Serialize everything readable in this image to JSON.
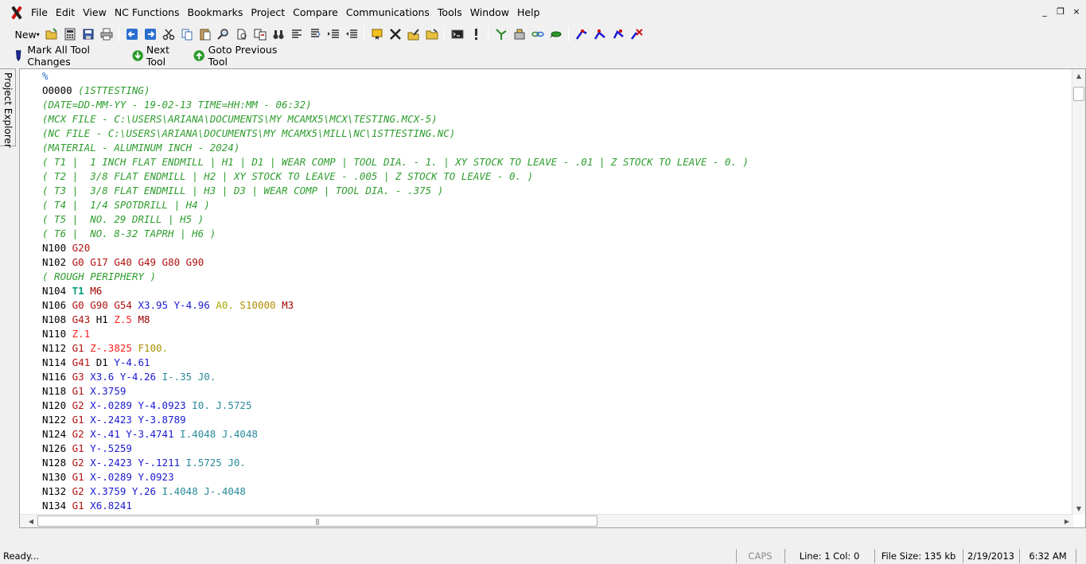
{
  "menubar": {
    "items": [
      "File",
      "Edit",
      "View",
      "NC Functions",
      "Bookmarks",
      "Project",
      "Compare",
      "Communications",
      "Tools",
      "Window",
      "Help"
    ],
    "mdi_controls": [
      "_",
      "❐",
      "×"
    ]
  },
  "toolbar": {
    "new_label": "New",
    "new_arrow": "▾"
  },
  "toolbar2": {
    "mark_all": "Mark All Tool Changes",
    "next_tool": "Next Tool",
    "goto_previous": "Goto Previous Tool"
  },
  "side_panel": {
    "label": "Project Explorer"
  },
  "editor": {
    "lines": [
      [
        [
          "P",
          "%"
        ]
      ],
      [
        [
          "O",
          "O0000"
        ],
        [
          "c",
          "(1STTESTING)"
        ]
      ],
      [
        [
          "c",
          "(DATE=DD-MM-YY - 19-02-13 TIME=HH:MM - 06:32)"
        ]
      ],
      [
        [
          "c",
          "(MCX FILE - C:\\USERS\\ARIANA\\DOCUMENTS\\MY MCAMX5\\MCX\\TESTING.MCX-5)"
        ]
      ],
      [
        [
          "c",
          "(NC FILE - C:\\USERS\\ARIANA\\DOCUMENTS\\MY MCAMX5\\MILL\\NC\\1STTESTING.NC)"
        ]
      ],
      [
        [
          "c",
          "(MATERIAL - ALUMINUM INCH - 2024)"
        ]
      ],
      [
        [
          "c",
          "( T1 |  1 INCH FLAT ENDMILL | H1 | D1 | WEAR COMP | TOOL DIA. - 1. | XY STOCK TO LEAVE - .01 | Z STOCK TO LEAVE - 0. )"
        ]
      ],
      [
        [
          "c",
          "( T2 |  3/8 FLAT ENDMILL | H2 | XY STOCK TO LEAVE - .005 | Z STOCK TO LEAVE - 0. )"
        ]
      ],
      [
        [
          "c",
          "( T3 |  3/8 FLAT ENDMILL | H3 | D3 | WEAR COMP | TOOL DIA. - .375 )"
        ]
      ],
      [
        [
          "c",
          "( T4 |  1/4 SPOTDRILL | H4 )"
        ]
      ],
      [
        [
          "c",
          "( T5 |  NO. 29 DRILL | H5 )"
        ]
      ],
      [
        [
          "c",
          "( T6 |  NO. 8-32 TAPRH | H6 )"
        ]
      ],
      [
        [
          "N",
          "N100"
        ],
        [
          "G",
          "G20"
        ]
      ],
      [
        [
          "N",
          "N102"
        ],
        [
          "G",
          "G0"
        ],
        [
          "G",
          "G17"
        ],
        [
          "G",
          "G40"
        ],
        [
          "G",
          "G49"
        ],
        [
          "G",
          "G80"
        ],
        [
          "G",
          "G90"
        ]
      ],
      [
        [
          "c",
          "( ROUGH PERIPHERY )"
        ]
      ],
      [
        [
          "N",
          "N104"
        ],
        [
          "T",
          "T1"
        ],
        [
          "M",
          "M6"
        ]
      ],
      [
        [
          "N",
          "N106"
        ],
        [
          "G",
          "G0"
        ],
        [
          "G",
          "G90"
        ],
        [
          "G",
          "G54"
        ],
        [
          "X",
          "X3.95"
        ],
        [
          "Y",
          "Y-4.96"
        ],
        [
          "A",
          "A0."
        ],
        [
          "S",
          "S10000"
        ],
        [
          "M",
          "M3"
        ]
      ],
      [
        [
          "N",
          "N108"
        ],
        [
          "G",
          "G43"
        ],
        [
          "H",
          "H1"
        ],
        [
          "Z",
          "Z.5"
        ],
        [
          "M",
          "M8"
        ]
      ],
      [
        [
          "N",
          "N110"
        ],
        [
          "Z",
          "Z.1"
        ]
      ],
      [
        [
          "N",
          "N112"
        ],
        [
          "G",
          "G1"
        ],
        [
          "Z",
          "Z-.3825"
        ],
        [
          "F",
          "F100."
        ]
      ],
      [
        [
          "N",
          "N114"
        ],
        [
          "G",
          "G41"
        ],
        [
          "D",
          "D1"
        ],
        [
          "Y",
          "Y-4.61"
        ]
      ],
      [
        [
          "N",
          "N116"
        ],
        [
          "G",
          "G3"
        ],
        [
          "X",
          "X3.6"
        ],
        [
          "Y",
          "Y-4.26"
        ],
        [
          "I",
          "I-.35"
        ],
        [
          "J",
          "J0."
        ]
      ],
      [
        [
          "N",
          "N118"
        ],
        [
          "G",
          "G1"
        ],
        [
          "X",
          "X.3759"
        ]
      ],
      [
        [
          "N",
          "N120"
        ],
        [
          "G",
          "G2"
        ],
        [
          "X",
          "X-.0289"
        ],
        [
          "Y",
          "Y-4.0923"
        ],
        [
          "I",
          "I0."
        ],
        [
          "J",
          "J.5725"
        ]
      ],
      [
        [
          "N",
          "N122"
        ],
        [
          "G",
          "G1"
        ],
        [
          "X",
          "X-.2423"
        ],
        [
          "Y",
          "Y-3.8789"
        ]
      ],
      [
        [
          "N",
          "N124"
        ],
        [
          "G",
          "G2"
        ],
        [
          "X",
          "X-.41"
        ],
        [
          "Y",
          "Y-3.4741"
        ],
        [
          "I",
          "I.4048"
        ],
        [
          "J",
          "J.4048"
        ]
      ],
      [
        [
          "N",
          "N126"
        ],
        [
          "G",
          "G1"
        ],
        [
          "Y",
          "Y-.5259"
        ]
      ],
      [
        [
          "N",
          "N128"
        ],
        [
          "G",
          "G2"
        ],
        [
          "X",
          "X-.2423"
        ],
        [
          "Y",
          "Y-.1211"
        ],
        [
          "I",
          "I.5725"
        ],
        [
          "J",
          "J0."
        ]
      ],
      [
        [
          "N",
          "N130"
        ],
        [
          "G",
          "G1"
        ],
        [
          "X",
          "X-.0289"
        ],
        [
          "Y",
          "Y.0923"
        ]
      ],
      [
        [
          "N",
          "N132"
        ],
        [
          "G",
          "G2"
        ],
        [
          "X",
          "X.3759"
        ],
        [
          "Y",
          "Y.26"
        ],
        [
          "I",
          "I.4048"
        ],
        [
          "J",
          "J-.4048"
        ]
      ],
      [
        [
          "N",
          "N134"
        ],
        [
          "G",
          "G1"
        ],
        [
          "X",
          "X6.8241"
        ]
      ]
    ]
  },
  "statusbar": {
    "ready": "Ready...",
    "caps": "CAPS",
    "line_col": "Line:  1  Col:  0",
    "file_size": "File Size: 135 kb",
    "date": "2/19/2013",
    "time": "6:32 AM"
  },
  "colors": {
    "comment": "#2e9d2e",
    "g_code": "#b01010",
    "xy_coord": "#1a1ad0",
    "z_coord": "#ff1e1e",
    "ij_coord": "#2a8a9a",
    "tool": "#00a080"
  }
}
